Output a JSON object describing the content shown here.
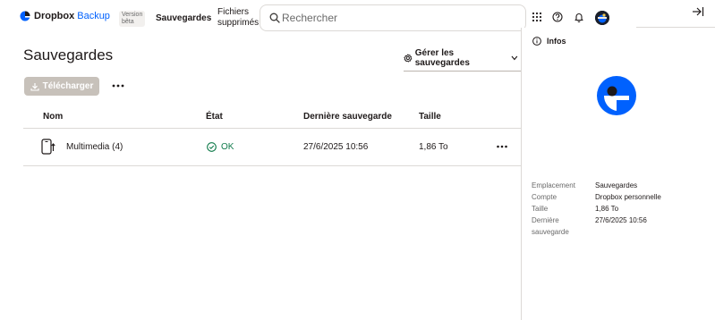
{
  "header": {
    "brand": "Dropbox",
    "product": "Backup",
    "beta_badge_line1": "Version",
    "beta_badge_line2": "bêta",
    "nav": {
      "backups": "Sauvegardes",
      "deleted_line1": "Fichiers",
      "deleted_line2": "supprimés"
    },
    "search": {
      "placeholder": "Rechercher",
      "value": ""
    },
    "icons": [
      "apps-grid-icon",
      "help-icon",
      "bell-icon",
      "avatar",
      "collapse-panel-icon"
    ]
  },
  "main": {
    "title": "Sauvegardes",
    "manage_label": "Gérer les sauvegardes",
    "download_label": "Télécharger",
    "columns": [
      "Nom",
      "État",
      "Dernière sauvegarde",
      "Taille"
    ],
    "rows": [
      {
        "name": "Multimedia (4)",
        "state": "OK",
        "last_backup": "27/6/2025 10:56",
        "size": "1,86 To"
      }
    ]
  },
  "panel": {
    "title": "Infos",
    "details": [
      {
        "key": "Emplacement",
        "value": "Sauvegardes"
      },
      {
        "key": "Compte",
        "value": "Dropbox personnelle"
      },
      {
        "key": "Taille",
        "value": "1,86 To"
      },
      {
        "key_line1": "Dernière",
        "key_line2": "sauvegarde",
        "value": "27/6/2025 10:56"
      }
    ]
  },
  "colors": {
    "accent": "#0061fe",
    "ok": "#0f7a4a",
    "disabled_button": "#c7c1ba",
    "border": "#dcd9d6"
  }
}
